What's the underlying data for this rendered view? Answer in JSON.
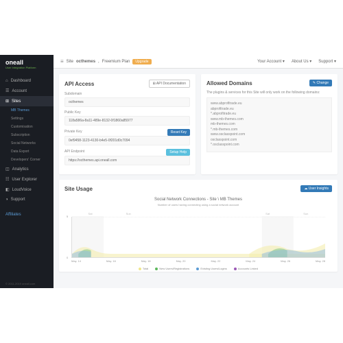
{
  "logo": {
    "main": "oneall",
    "sub": "User Integration Platform"
  },
  "nav": {
    "items": [
      {
        "label": "Dashboard",
        "icon": "⚙"
      },
      {
        "label": "Account",
        "icon": "👤"
      },
      {
        "label": "Sites",
        "icon": "⊞",
        "active": true
      }
    ],
    "subs": [
      "MB Themes",
      "Settings",
      "Customisation",
      "Subscription",
      "Social Networks",
      "Data Export",
      "Developers' Corner"
    ],
    "items2": [
      {
        "label": "Analytics",
        "icon": "📊"
      },
      {
        "label": "User Explorer",
        "icon": "👥"
      },
      {
        "label": "LoudVoice",
        "icon": "💬"
      },
      {
        "label": "Support",
        "icon": "✉"
      }
    ],
    "affiliates": "Affiliates"
  },
  "breadcrumb": {
    "site": "Site",
    "name": "octhemes",
    "plan": "Freemium Plan",
    "upgrade": "Upgrade"
  },
  "toplinks": [
    "Your Account ▾",
    "About Us ▾",
    "Support ▾"
  ],
  "api": {
    "title": "API Access",
    "doc": "⊞ API Documentation",
    "subdomain": {
      "label": "Subdomain",
      "value": "octhemes"
    },
    "publicKey": {
      "label": "Public Key",
      "value": "118a586a-8a11-489e-8132-0f1860a85977"
    },
    "privateKey": {
      "label": "Private Key",
      "value": "0ef9458-1123-4130-b4e5-0f201d0c7094",
      "btn": "Reset Key"
    },
    "endpoint": {
      "label": "API Endpoint",
      "value": "https://octhemes.api.oneall.com",
      "btn": "Setup Help"
    }
  },
  "domains": {
    "title": "Allowed Domains",
    "change": "✎ Change",
    "intro": "The plugins & services for this Site will only work on the following domains:",
    "list": [
      "www.abprofitrade.eu",
      "abprofitrade.eu",
      "*.abprofitrade.eu",
      "www.mb-themes.com",
      "mb-themes.com",
      "*.mb-themes.com",
      "www.osclasspoint.com",
      "osclasspoint.com",
      "*.osclasspoint.com"
    ]
  },
  "usage": {
    "title": "Site Usage",
    "insights": "☁ User Insights",
    "chartTitle": "Social Network Connections - Site \\ MB Themes",
    "chartSub": "Number of users having connecting using a social network account",
    "ylabels": [
      "5",
      "0"
    ],
    "days": [
      "Sat",
      "Sun",
      "Sat",
      "Sun"
    ],
    "xlabels": [
      "May. 14",
      "May. 16",
      "May. 18",
      "May. 20",
      "May. 22",
      "May. 24",
      "May. 26",
      "May. 28"
    ],
    "legend": [
      {
        "label": "Total",
        "color": "#f0e68c"
      },
      {
        "label": "New Users/Registrations",
        "color": "#5cb85c"
      },
      {
        "label": "Existing Users/Logins",
        "color": "#5b9bd5"
      },
      {
        "label": "Accounts Linked",
        "color": "#9b59b6"
      }
    ]
  },
  "footer": "© 2011-2019 oneall.com",
  "chart_data": {
    "type": "line",
    "title": "Social Network Connections - Site \\ MB Themes",
    "xlabel": "",
    "ylabel": "",
    "ylim": [
      0,
      5
    ],
    "categories": [
      "May. 14",
      "May. 16",
      "May. 18",
      "May. 20",
      "May. 22",
      "May. 24",
      "May. 26",
      "May. 28"
    ],
    "series": [
      {
        "name": "Total",
        "values": [
          1,
          2,
          1,
          0,
          0,
          1,
          2,
          3
        ]
      },
      {
        "name": "New Users/Registrations",
        "values": [
          0,
          1,
          0,
          0,
          0,
          0,
          1,
          1
        ]
      },
      {
        "name": "Existing Users/Logins",
        "values": [
          1,
          1,
          1,
          0,
          0,
          1,
          1,
          2
        ]
      },
      {
        "name": "Accounts Linked",
        "values": [
          0,
          0,
          0,
          0,
          0,
          0,
          0,
          0
        ]
      }
    ]
  }
}
